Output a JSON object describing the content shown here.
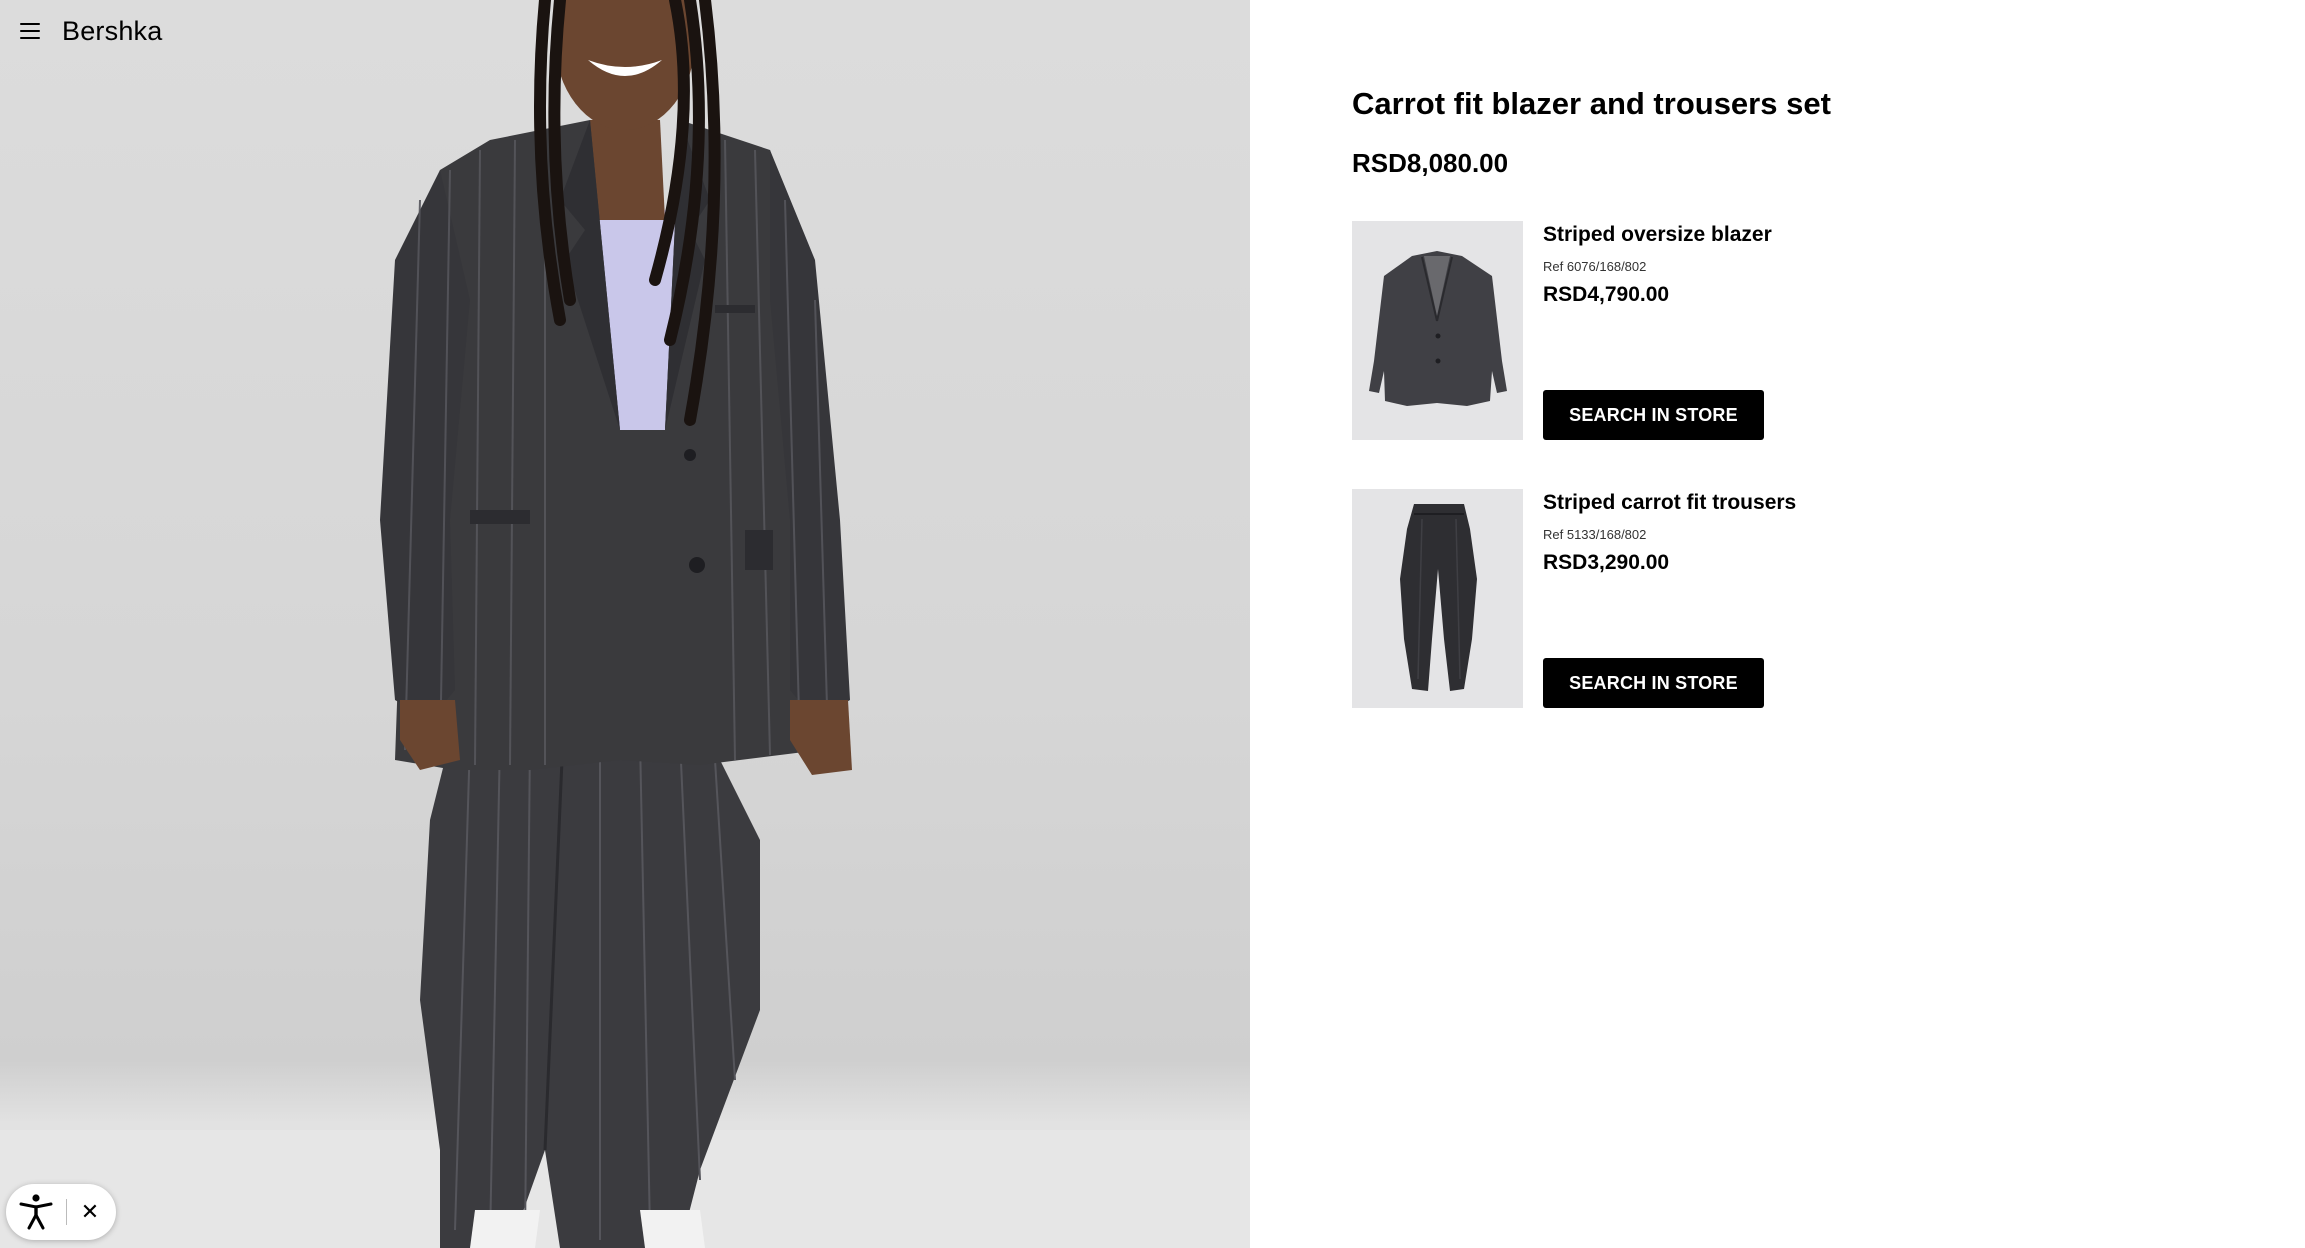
{
  "header": {
    "brand": "Bershka",
    "menu_icon": "hamburger-menu-icon"
  },
  "hero_image": {
    "alt": "Model wearing striped carrot fit blazer and trousers set"
  },
  "accessibility_widget": {
    "icon": "accessibility-icon",
    "close_label": "✕"
  },
  "product": {
    "title": "Carrot fit blazer and trousers set",
    "price": "RSD8,080.00",
    "items": [
      {
        "name": "Striped oversize blazer",
        "ref": "Ref 6076/168/802",
        "price": "RSD4,790.00",
        "button_label": "SEARCH IN STORE",
        "thumbnail": "blazer-thumbnail"
      },
      {
        "name": "Striped carrot fit trousers",
        "ref": "Ref 5133/168/802",
        "price": "RSD3,290.00",
        "button_label": "SEARCH IN STORE",
        "thumbnail": "trousers-thumbnail"
      }
    ]
  },
  "colors": {
    "button_bg": "#000000",
    "button_text": "#ffffff",
    "hero_bg": "#d8d8d8",
    "suit": "#3a3a3d",
    "top": "#c9c7ea"
  }
}
